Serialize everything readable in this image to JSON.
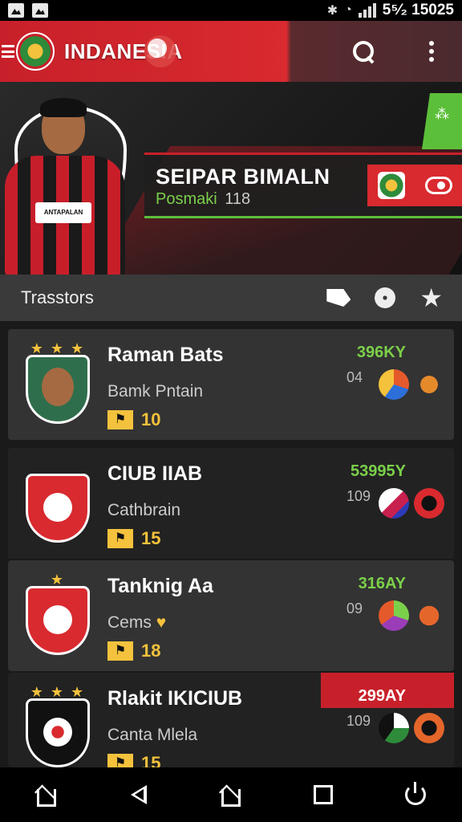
{
  "status_bar": {
    "time": "5⁵⁄₂ 15025",
    "left_icons": [
      "image-icon",
      "image-icon"
    ],
    "right_icons": [
      "bluetooth-icon",
      "wifi-icon",
      "signal-icon"
    ]
  },
  "header": {
    "title": "INDANESIA",
    "icons": [
      "menu-icon",
      "logo-icon",
      "search-icon",
      "more-icon"
    ]
  },
  "hero": {
    "name": "SEIPAR BIMALN",
    "sub_label": "Posmaki",
    "sub_value": "118",
    "player_sponsor": "ANTAPALAN"
  },
  "section": {
    "title": "Trasstors",
    "icons": [
      "flag-icon",
      "gear-icon",
      "star-icon"
    ]
  },
  "items": [
    {
      "name": "Raman Bats",
      "sub": "Bamk Pntain",
      "sub_accent": "",
      "badge": "10",
      "value": "396KY",
      "count": "04",
      "crest_color": "#2f6e4c"
    },
    {
      "name": "CIUB IIAB",
      "sub": "Cathbrain",
      "sub_accent": "",
      "badge": "15",
      "value": "53995Y",
      "count": "109",
      "crest_color": "#d82a2f"
    },
    {
      "name": "Tanknig Aa",
      "sub": "Cems",
      "sub_accent": "♥",
      "badge": "18",
      "value": "316AY",
      "count": "09",
      "crest_color": "#d82a2f"
    },
    {
      "name": "Rlakit IKICIUB",
      "sub": "Canta Mlela",
      "sub_accent": "",
      "badge": "15",
      "value": "299AY",
      "count": "109",
      "crest_color": "#111111"
    }
  ],
  "colors": {
    "brand_red": "#d82a2f",
    "accent_green": "#7bd04a",
    "badge_gold": "#f4c23c"
  },
  "nav": {
    "icons": [
      "home-icon",
      "back-icon",
      "home-icon",
      "recents-icon",
      "power-icon"
    ]
  }
}
